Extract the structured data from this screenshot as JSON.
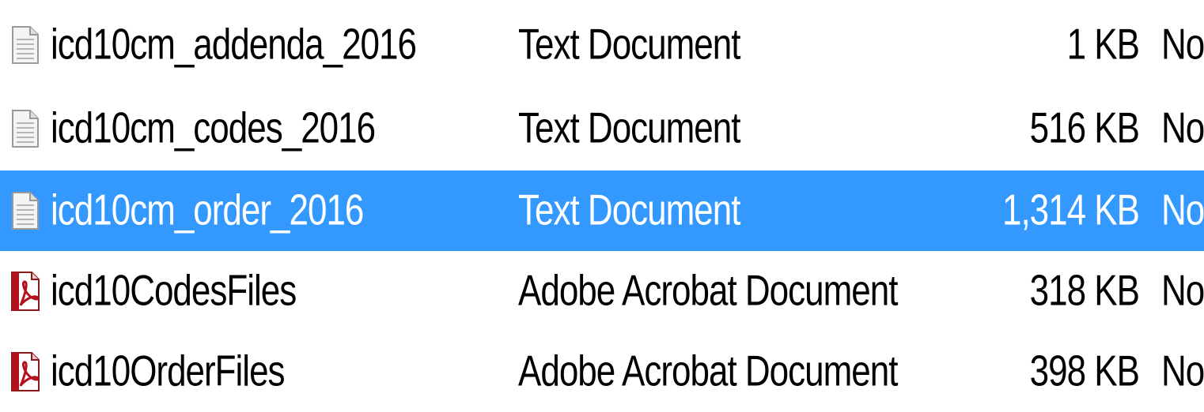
{
  "files": [
    {
      "icon": "text-document-icon",
      "name": "icd10cm_addenda_2016",
      "type": "Text Document",
      "size": "1 KB",
      "extra": "No",
      "selected": false
    },
    {
      "icon": "text-document-icon",
      "name": "icd10cm_codes_2016",
      "type": "Text Document",
      "size": "516 KB",
      "extra": "No",
      "selected": false
    },
    {
      "icon": "text-document-icon",
      "name": "icd10cm_order_2016",
      "type": "Text Document",
      "size": "1,314 KB",
      "extra": "No",
      "selected": true
    },
    {
      "icon": "pdf-document-icon",
      "name": "icd10CodesFiles",
      "type": "Adobe Acrobat Document",
      "size": "318 KB",
      "extra": "No",
      "selected": false
    },
    {
      "icon": "pdf-document-icon",
      "name": "icd10OrderFiles",
      "type": "Adobe Acrobat Document",
      "size": "398 KB",
      "extra": "No",
      "selected": false
    }
  ],
  "colors": {
    "selection": "#3399ff",
    "pdf_red": "#b3121c"
  }
}
